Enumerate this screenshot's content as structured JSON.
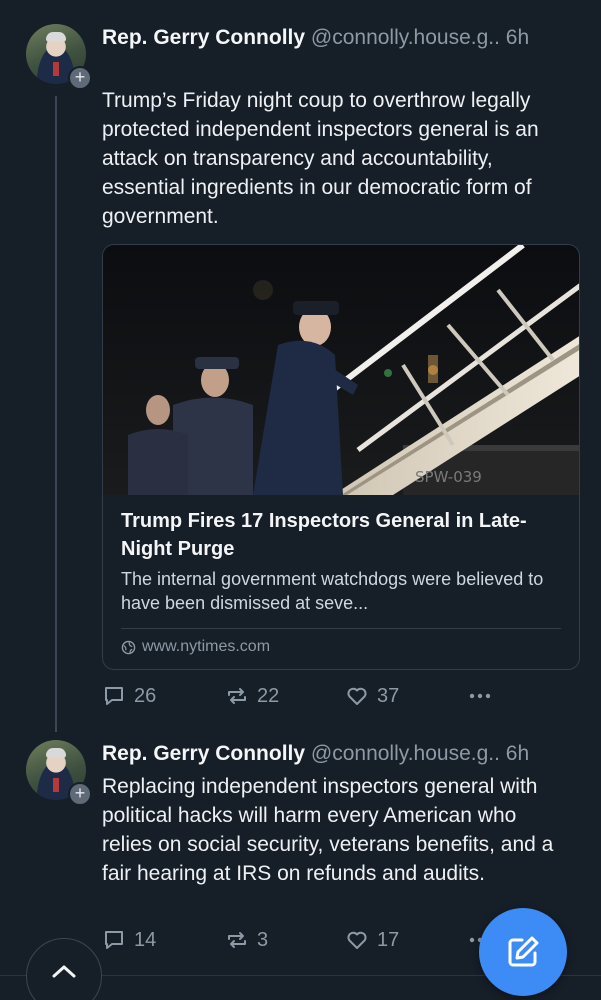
{
  "posts": [
    {
      "author": "Rep. Gerry Connolly",
      "handle": "@connolly.house.g..",
      "time": "6h",
      "text": "Trump’s Friday night coup to overthrow legally protected independent inspectors general is an attack on transparency and accountability, essential ingredients in our democratic form of government.",
      "card": {
        "title": "Trump Fires 17 Inspectors General in Late-Night Purge",
        "description": "The internal government watchdogs were believed to have been dismissed at seve...",
        "domain": "www.nytimes.com",
        "image_text": "SPW-039"
      },
      "replies": "26",
      "reposts": "22",
      "likes": "37"
    },
    {
      "author": "Rep. Gerry Connolly",
      "handle": "@connolly.house.g..",
      "time": "6h",
      "text": "Replacing independent inspectors general with political hacks will harm every American who relies on social security, veterans benefits, and a fair hearing at IRS on refunds and audits.",
      "replies": "14",
      "reposts": "3",
      "likes": "17"
    }
  ],
  "icons": {
    "reply": "speech-bubble-icon",
    "repost": "repost-arrows-icon",
    "like": "heart-icon",
    "more": "ellipsis-icon",
    "scroll_up": "chevron-up-icon",
    "compose": "compose-pencil-icon",
    "globe": "globe-icon"
  },
  "colors": {
    "background": "#161e27",
    "accent": "#3d8bf5",
    "muted": "#8d99a6"
  }
}
